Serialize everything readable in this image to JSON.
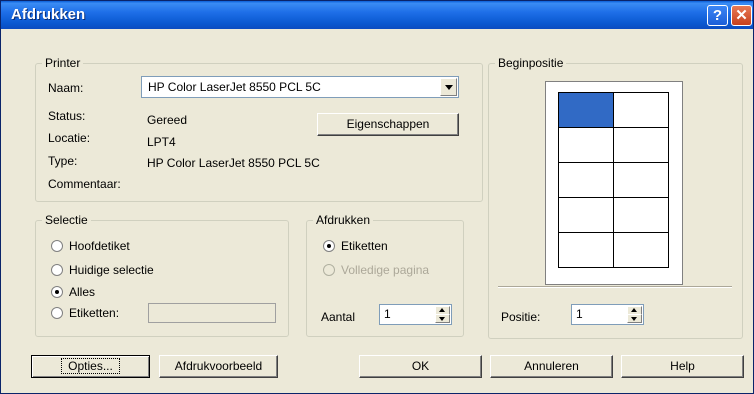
{
  "window": {
    "title": "Afdrukken",
    "help_glyph": "?",
    "close_glyph": "✕"
  },
  "printer": {
    "legend": "Printer",
    "naam_label": "Naam:",
    "naam_value": "HP Color LaserJet 8550 PCL 5C",
    "status_label": "Status:",
    "status_value": "Gereed",
    "locatie_label": "Locatie:",
    "locatie_value": "LPT4",
    "type_label": "Type:",
    "type_value": "HP Color LaserJet 8550 PCL 5C",
    "commentaar_label": "Commentaar:",
    "commentaar_value": "",
    "eigenschappen_button": "Eigenschappen"
  },
  "selectie": {
    "legend": "Selectie",
    "options": [
      "Hoofdetiket",
      "Huidige selectie",
      "Alles",
      "Etiketten:"
    ],
    "selected": "Alles",
    "etiketten_value": ""
  },
  "afdrukken": {
    "legend": "Afdrukken",
    "options": [
      "Etiketten",
      "Volledige pagina"
    ],
    "selected": "Etiketten",
    "disabled": [
      "Volledige pagina"
    ],
    "aantal_label": "Aantal",
    "aantal_value": "1"
  },
  "beginpositie": {
    "legend": "Beginpositie",
    "rows": 5,
    "cols": 2,
    "selected_cell": 1,
    "positie_label": "Positie:",
    "positie_value": "1"
  },
  "buttons": {
    "opties": "Opties...",
    "afdrukvoorbeeld": "Afdrukvoorbeeld",
    "ok": "OK",
    "annuleren": "Annuleren",
    "help": "Help"
  },
  "colors": {
    "accent": "#316AC5",
    "titlebar": "#0A58D0",
    "dialog_bg": "#ECE9D8"
  }
}
